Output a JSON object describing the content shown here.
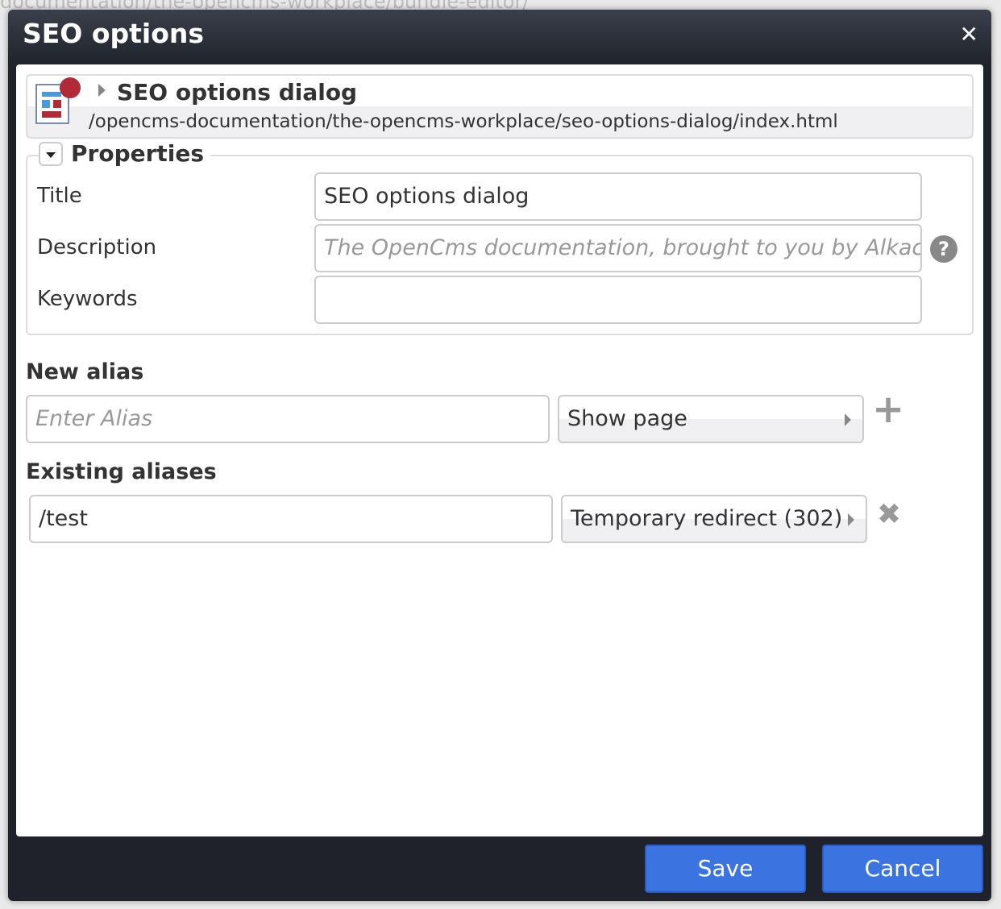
{
  "background": {
    "path_text": "documentation/the-opencms-workplace/bundle-editor/"
  },
  "dialog": {
    "title": "SEO options",
    "close_icon": "close-icon"
  },
  "resource": {
    "title": "SEO options dialog",
    "path": "/opencms-documentation/the-opencms-workplace/seo-options-dialog/index.html",
    "icon": "page-icon",
    "badge_color": "#b02a37"
  },
  "properties": {
    "legend": "Properties",
    "title_label": "Title",
    "title_value": "SEO options dialog",
    "description_label": "Description",
    "description_placeholder": "The OpenCms documentation, brought to you by Alkacon",
    "keywords_label": "Keywords",
    "keywords_value": "",
    "help": "?"
  },
  "new_alias": {
    "heading": "New alias",
    "placeholder": "Enter Alias",
    "mode": "Show page",
    "add": "+"
  },
  "existing_aliases": {
    "heading": "Existing aliases",
    "items": [
      {
        "path": "/test",
        "mode": "Temporary redirect (302)"
      }
    ],
    "remove": "✖"
  },
  "buttons": {
    "save": "Save",
    "cancel": "Cancel",
    "accent": "#3b74e0"
  }
}
